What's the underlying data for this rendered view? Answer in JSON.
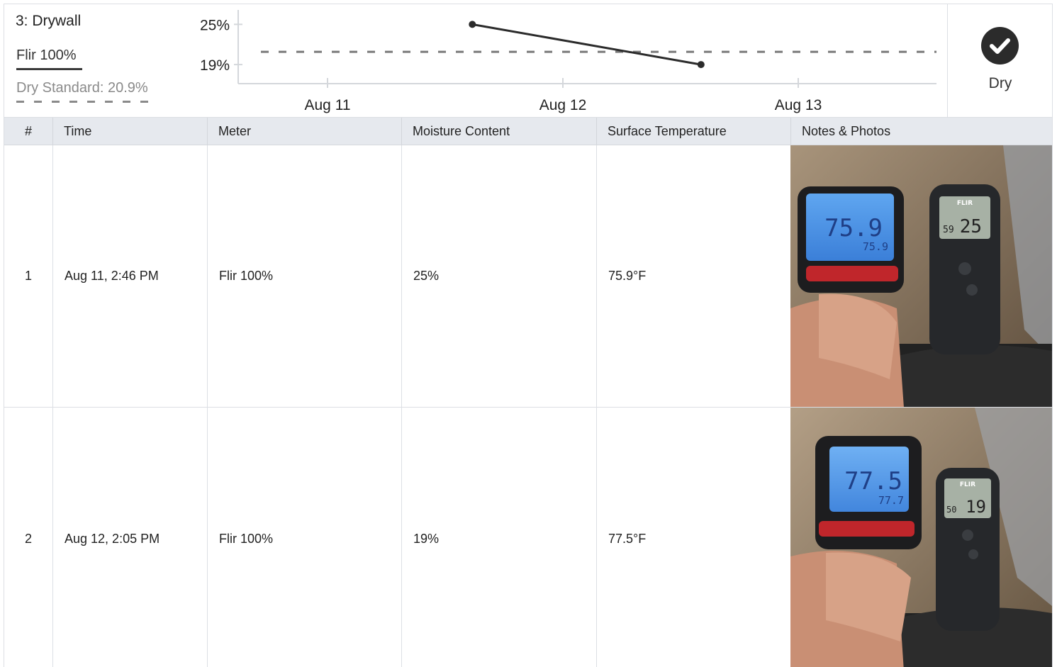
{
  "header": {
    "room_title": "3: Drywall",
    "legend_meter": "Flir 100%",
    "legend_standard": "Dry Standard: 20.9%",
    "status_label": "Dry",
    "status_icon": "check-circle-icon"
  },
  "chart_data": {
    "type": "line",
    "x_ticks": [
      "Aug 11",
      "Aug 12",
      "Aug 13"
    ],
    "y_ticks": [
      "25%",
      "19%"
    ],
    "series": [
      {
        "name": "Flir 100%",
        "x": [
          "Aug 11, 2:46 PM",
          "Aug 12, 2:05 PM"
        ],
        "y": [
          25,
          19
        ],
        "color": "#2b2b2b"
      }
    ],
    "reference_line": {
      "name": "Dry Standard: 20.9%",
      "y": 20.9,
      "color": "#7a7a7a",
      "style": "dashed"
    },
    "ylim": [
      17,
      28
    ],
    "grid": false
  },
  "table": {
    "headers": [
      "#",
      "Time",
      "Meter",
      "Moisture Content",
      "Surface Temperature",
      "Notes & Photos"
    ],
    "rows": [
      {
        "num": "1",
        "time": "Aug 11, 2:46 PM",
        "meter": "Flir 100%",
        "moisture": "25%",
        "temp": "75.9°F",
        "photo": {
          "gun_main": "75.9",
          "gun_sub": "75.9",
          "meter_reading": "25",
          "meter_left": "59",
          "brand": "FLIR"
        }
      },
      {
        "num": "2",
        "time": "Aug 12, 2:05 PM",
        "meter": "Flir 100%",
        "moisture": "19%",
        "temp": "77.5°F",
        "photo": {
          "gun_main": "77.5",
          "gun_sub": "77.7",
          "meter_reading": "19",
          "meter_left": "50",
          "brand": "FLIR"
        }
      }
    ]
  }
}
